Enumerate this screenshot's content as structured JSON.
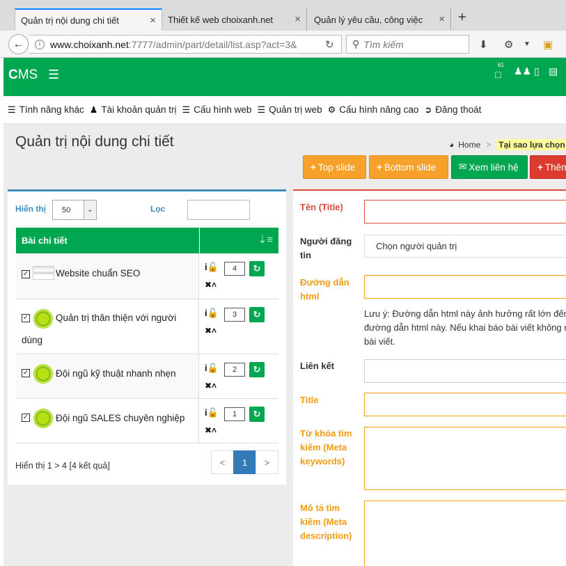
{
  "browser": {
    "tabs": [
      {
        "label": "Quản trị nội dung chi tiết"
      },
      {
        "label": "Thiết kế web choixanh.net"
      },
      {
        "label": "Quản lý yêu cầu, công việc"
      }
    ],
    "close_glyph": "×",
    "new_tab_glyph": "+",
    "url_host": "www.choixanh.net",
    "url_rest": ":7777/admin/part/detail/list.asp?act=3&",
    "search_placeholder": "Tìm kiếm"
  },
  "cms": {
    "brand_c": "C",
    "brand_rest": "MS",
    "badge": "61"
  },
  "menu": [
    {
      "label": "Tính năng khác",
      "icon": "list-icon"
    },
    {
      "label": "Tài khoản quản trị",
      "icon": "user-icon"
    },
    {
      "label": "Cấu hình web",
      "icon": "list-icon"
    },
    {
      "label": "Quản trị web",
      "icon": "list-icon"
    },
    {
      "label": "Cấu hình nâng cao",
      "icon": "gear-icon"
    },
    {
      "label": "Đăng thoát",
      "icon": "sign-out-icon"
    }
  ],
  "page": {
    "title": "Quản trị nội dung chi tiết",
    "breadcrumb_home": "Home",
    "breadcrumb_current": "Tại sao lựa chọn ch"
  },
  "actions": {
    "top_slide": "Top slide",
    "bottom_slide": "Bottom slide",
    "view_contact": "Xem liên hệ",
    "add": "Thêm"
  },
  "list": {
    "show_label": "Hiển thị",
    "page_size": "50",
    "filter_label": "Lọc",
    "header": "Bài chi tiết",
    "rows": [
      {
        "title": "Website chuẩn SEO",
        "order": "4"
      },
      {
        "title": "Quản trị thân thiện với người dùng",
        "order": "3"
      },
      {
        "title": "Đội ngũ kỹ thuật nhanh nhẹn",
        "order": "2"
      },
      {
        "title": "Đội ngũ SALES chuyên nghiệp",
        "order": "1"
      }
    ],
    "summary": "Hiển thị 1 > 4 [4 kết quả]",
    "pager": {
      "prev": "<",
      "current": "1",
      "next": ">"
    }
  },
  "form": {
    "title_label": "Tên (Title)",
    "author_label": "Người đăng tin",
    "author_value": "Chọn người quản trị",
    "path_label": "Đường dẫn html",
    "note": "Lưu ý: Đường dẫn html này ảnh hưởng rất lớn đến\nđường dẫn html này. Nếu khai báo bài viết không n\nbài viết.",
    "link_label": "Liên kết",
    "seo_title_label": "Title",
    "keywords_label": "Từ khóa tìm kiếm (Meta keywords)",
    "description_label": "Mô tả tìm kiếm (Meta description)"
  },
  "colors": {
    "green": "#00a650",
    "orange": "#f7a12b",
    "red": "#dd3b2f",
    "blue": "#3c8dbc"
  }
}
